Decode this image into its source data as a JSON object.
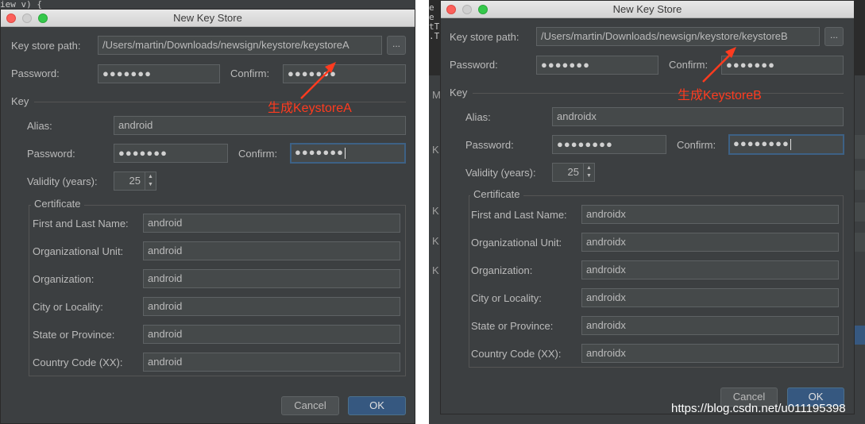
{
  "title": "New Key Store",
  "labels": {
    "keystore_path": "Key store path:",
    "password": "Password:",
    "confirm": "Confirm:",
    "key_section": "Key",
    "alias": "Alias:",
    "validity": "Validity (years):",
    "certificate": "Certificate",
    "first_last_name": "First and Last Name:",
    "org_unit": "Organizational Unit:",
    "organization": "Organization:",
    "city": "City or Locality:",
    "state": "State or Province:",
    "country": "Country Code (XX):",
    "cancel": "Cancel",
    "ok": "OK",
    "browse": "..."
  },
  "left": {
    "keystore_path": "/Users/martin/Downloads/newsign/keystore/keystoreA",
    "keystore_password": "●●●●●●●",
    "keystore_confirm": "●●●●●●●",
    "alias": "android",
    "key_password": "●●●●●●●",
    "key_confirm": "●●●●●●●",
    "validity": "25",
    "first_last_name": "android",
    "org_unit": "android",
    "organization": "android",
    "city": "android",
    "state": "android",
    "country": "android",
    "annotation": "生成KeystoreA"
  },
  "right": {
    "keystore_path": "/Users/martin/Downloads/newsign/keystore/keystoreB",
    "keystore_password": "●●●●●●●",
    "keystore_confirm": "●●●●●●●",
    "alias": "androidx",
    "key_password": "●●●●●●●●",
    "key_confirm": "●●●●●●●●",
    "validity": "25",
    "first_last_name": "androidx",
    "org_unit": "androidx",
    "organization": "androidx",
    "city": "androidx",
    "state": "androidx",
    "country": "androidx",
    "annotation": "生成KeystoreB"
  },
  "background": {
    "code_left": "iew v) {",
    "code_right": "e\ne\ntT\n.T",
    "gutter_letters": [
      "M",
      "K",
      "K",
      "K",
      "K"
    ]
  },
  "watermark": "https://blog.csdn.net/u011195398",
  "colors": {
    "dialog_bg": "#3c3f41",
    "field_bg": "#45494a",
    "focus_border": "#3d6185",
    "ok_button": "#365880",
    "annotation": "#ff3b1f"
  }
}
